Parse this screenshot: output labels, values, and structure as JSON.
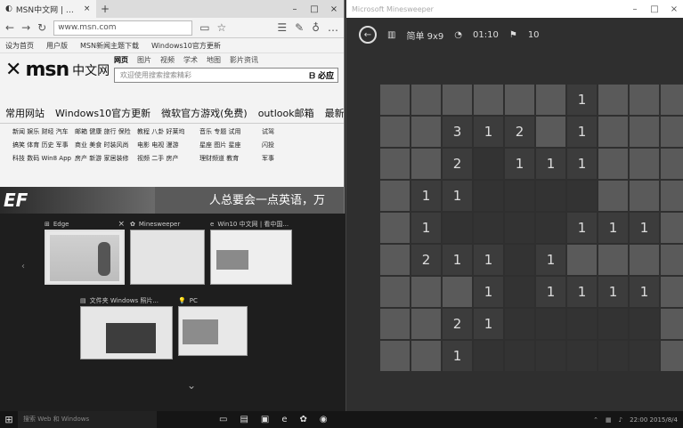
{
  "edge": {
    "tab_title": "MSN中文网 | 看中国网",
    "url": "www.msn.com",
    "favorites": [
      "设为首页",
      "用户版",
      "MSN新闻主题下载",
      "Windows10官方更新"
    ],
    "logo_text": "msn",
    "logo_cn": "中文网",
    "search_tabs": [
      "网页",
      "图片",
      "视频",
      "学术",
      "地图",
      "影片资讯"
    ],
    "search_placeholder": "欢迎使用搜索搜索精彩",
    "search_button": "必应",
    "nav_links": [
      "常用网站",
      "Windows10官方更新",
      "微软官方游戏(免费)",
      "outlook邮箱",
      "最新主题",
      "微软"
    ],
    "grid_links": [
      "新闻 娱乐 财经 汽车",
      "邮箱 健康 旅行 保险",
      "教程 八卦 好莱坞",
      "音乐 专题 试用",
      "试驾",
      "搞笑 体育 历史 军事",
      "商业 美食 时装风尚",
      "电影 电视 漫游",
      "星座 图片 星座",
      "闪投",
      "科技 数码 Win8 App",
      "房产 新游 家居装修",
      "视频 二手 房产",
      "理财频道 教育",
      "军事"
    ],
    "banner_text": "EF",
    "banner_slogan": "人总要会一点英语，万"
  },
  "taskview": {
    "thumbs": [
      {
        "title": "Edge",
        "has_close": true
      },
      {
        "title": "Minesweeper"
      },
      {
        "title": "Win10 中文网 | 看中国..."
      },
      {
        "title": "文件夹 Windows 照片..."
      },
      {
        "title": "PC"
      }
    ]
  },
  "mine": {
    "window_title": "Microsoft Minesweeper",
    "difficulty": "简单 9x9",
    "timer": "01:10",
    "flags": "10",
    "board": [
      [
        "c",
        "c",
        "c",
        "c",
        "c",
        "c",
        "1",
        "c",
        "c",
        "c"
      ],
      [
        "c",
        "c",
        "3",
        "1",
        "2",
        "c",
        "1",
        "c",
        "c",
        "c"
      ],
      [
        "c",
        "c",
        "2",
        "e",
        "1",
        "1",
        "1",
        "c",
        "c",
        "c"
      ],
      [
        "c",
        "1",
        "1",
        "e",
        "e",
        "e",
        "e",
        "c",
        "c",
        "c"
      ],
      [
        "c",
        "1",
        "e",
        "e",
        "e",
        "e",
        "1",
        "1",
        "1",
        "c"
      ],
      [
        "c",
        "2",
        "1",
        "1",
        "e",
        "1",
        "c",
        "c",
        "c",
        "c"
      ],
      [
        "c",
        "c",
        "c",
        "1",
        "e",
        "1",
        "1",
        "1",
        "1",
        "c"
      ],
      [
        "c",
        "c",
        "2",
        "1",
        "e",
        "e",
        "e",
        "e",
        "e",
        "c"
      ],
      [
        "c",
        "c",
        "1",
        "e",
        "e",
        "e",
        "e",
        "e",
        "e",
        "c"
      ]
    ]
  },
  "taskbar": {
    "search_placeholder": "搜索 Web 和 Windows",
    "time": "22:00",
    "date": "2015/8/4"
  }
}
